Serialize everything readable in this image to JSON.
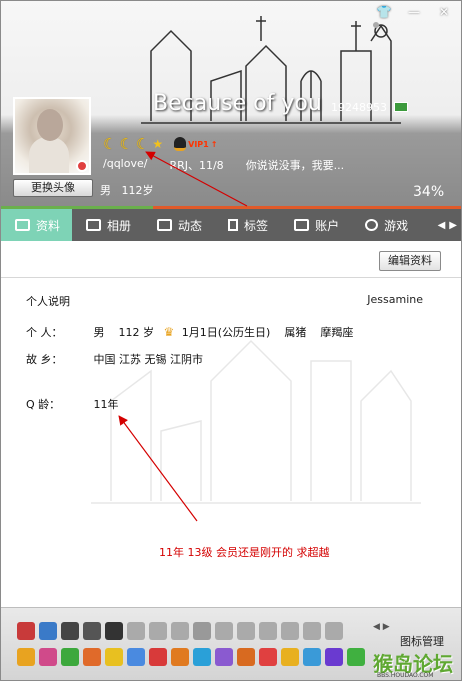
{
  "window": {
    "btn_skin": "👕",
    "btn_minimize": "—",
    "btn_close": "✕"
  },
  "profile": {
    "title": "Because of you",
    "qq_number": "19248953",
    "change_avatar_label": "更换头像",
    "gender": "男",
    "age": "112岁",
    "vip_label": "VIP1",
    "vip_arrow": "↑",
    "nickname": "/qqlove/",
    "status": "RRJ、11/8",
    "signature_preview": "你说说没事，我要...",
    "progress_percent": "34%"
  },
  "tabs": [
    {
      "label": "资料",
      "icon": "profile-card-icon",
      "active": true
    },
    {
      "label": "相册",
      "icon": "photo-album-icon",
      "active": false
    },
    {
      "label": "动态",
      "icon": "feed-list-icon",
      "active": false
    },
    {
      "label": "标签",
      "icon": "bookmark-icon",
      "active": false
    },
    {
      "label": "账户",
      "icon": "wallet-icon",
      "active": false
    },
    {
      "label": "游戏",
      "icon": "game-icon",
      "active": false
    }
  ],
  "content": {
    "edit_label": "编辑资料",
    "personal_desc_label": "个人说明",
    "signature_name": "Jessamine",
    "person_label": "个    人：",
    "person_gender": "男",
    "person_age": "112 岁",
    "person_birthday": "1月1日(公历生日)",
    "person_zodiac": "属猪",
    "person_constellation": "摩羯座",
    "hometown_label": "故    乡：",
    "hometown_value": "中国 江苏 无锡 江阴市",
    "qage_label": "Q      龄：",
    "qage_value": "11年",
    "annotation": "11年  13级  会员还是刚开的  求超越"
  },
  "iconbar": {
    "label": "图标管理",
    "pager": "◀ ▶",
    "watermark": "猴岛论坛",
    "watermark_sub": "BBS.HOUDAO.COM"
  },
  "colors": {
    "tab_active": "#7ed3b6",
    "tab_bar": "#5f5f5f",
    "annotation_red": "#d40000",
    "moon_gold": "#f3c21b"
  }
}
